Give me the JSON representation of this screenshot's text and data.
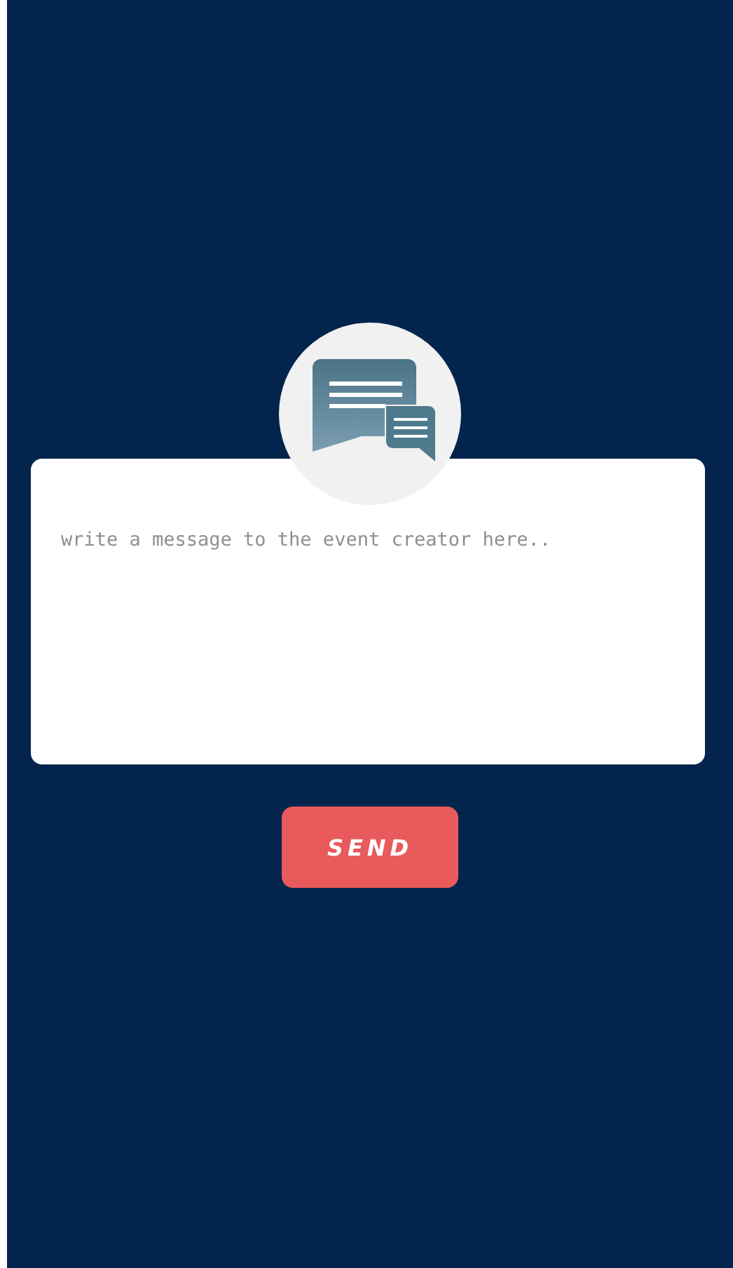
{
  "message": {
    "placeholder": "write a message to the event creator here.."
  },
  "send_button": {
    "label": "SEND"
  }
}
